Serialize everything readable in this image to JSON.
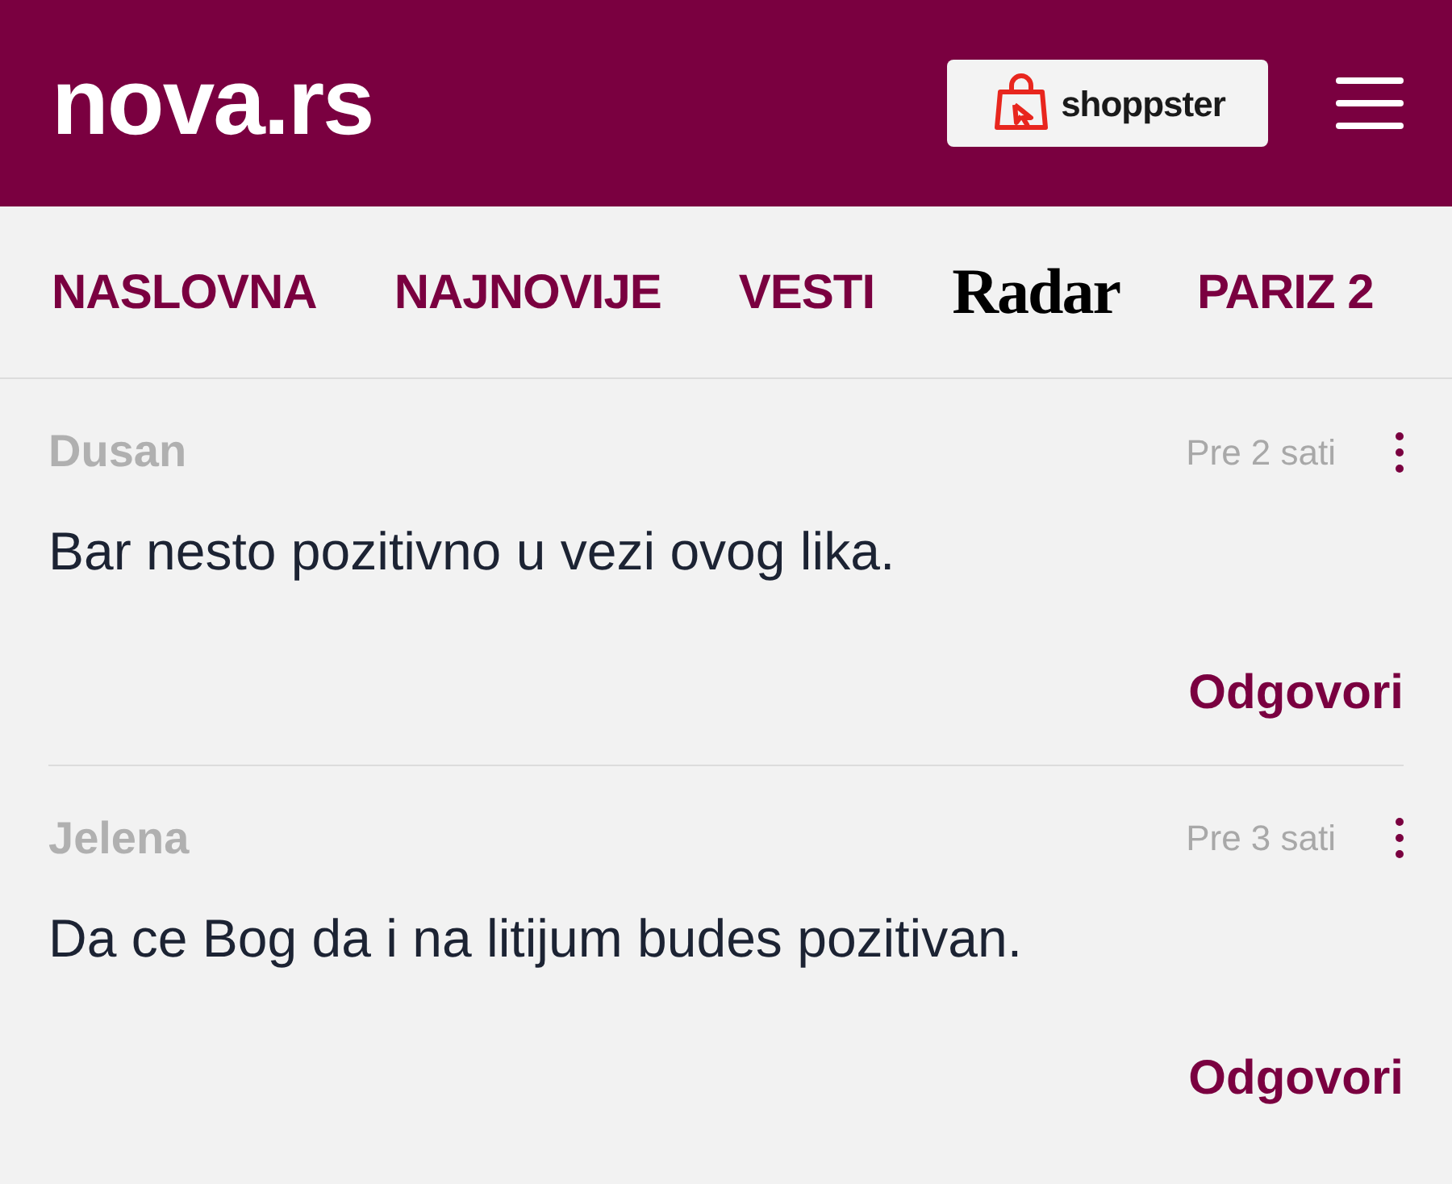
{
  "header": {
    "logo": "nova.rs",
    "shop_button": "shoppster"
  },
  "nav": [
    {
      "label": "NASLOVNA",
      "kind": "link"
    },
    {
      "label": "NAJNOVIJE",
      "kind": "link"
    },
    {
      "label": "VESTI",
      "kind": "link"
    },
    {
      "label": "Radar",
      "kind": "brand"
    },
    {
      "label": "PARIZ 2",
      "kind": "link"
    }
  ],
  "comments": [
    {
      "author": "Dusan",
      "time": "Pre 2 sati",
      "text": "Bar nesto pozitivno u vezi ovog lika.",
      "reply": "Odgovori"
    },
    {
      "author": "Jelena",
      "time": "Pre 3 sati",
      "text": "Da ce Bog da i na litijum budes pozitivan.",
      "reply": "Odgovori"
    }
  ]
}
